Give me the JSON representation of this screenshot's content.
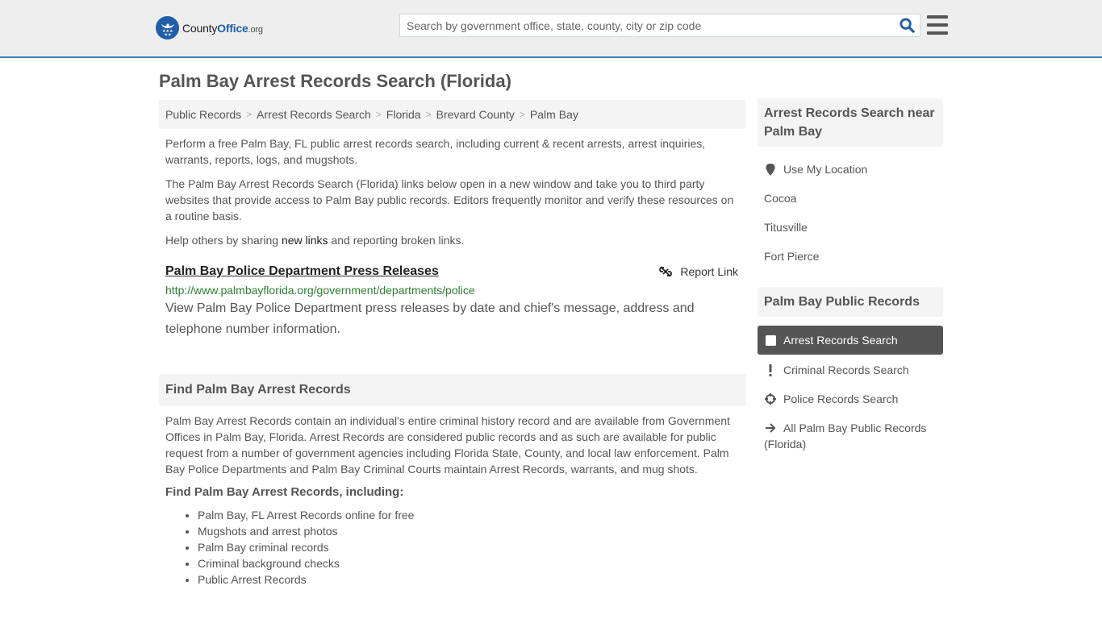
{
  "header": {
    "logo": {
      "name": "County",
      "brand": "Office",
      "tld": ".org"
    },
    "search": {
      "placeholder": "Search by government office, state, county, city or zip code",
      "value": ""
    },
    "colors": {
      "accent": "#3d7eb0",
      "brand": "#1f5fa8"
    }
  },
  "page": {
    "title": "Palm Bay Arrest Records Search (Florida)"
  },
  "breadcrumb": [
    {
      "label": "Public Records"
    },
    {
      "label": "Arrest Records Search"
    },
    {
      "label": "Florida"
    },
    {
      "label": "Brevard County"
    },
    {
      "label": "Palm Bay"
    }
  ],
  "breadcrumb_separator": ">",
  "intro": {
    "p1": "Perform a free Palm Bay, FL public arrest records search, including current & recent arrests, arrest inquiries, warrants, reports, logs, and mugshots.",
    "p2": "The Palm Bay Arrest Records Search (Florida) links below open in a new window and take you to third party websites that provide access to Palm Bay public records. Editors frequently monitor and verify these resources on a routine basis.",
    "p3_before": "Help others by sharing ",
    "p3_link": "new links",
    "p3_after": " and reporting broken links."
  },
  "links": [
    {
      "title": "Palm Bay Police Department Press Releases",
      "url": "http://www.palmbayflorida.org/government/departments/police",
      "description": "View Palm Bay Police Department press releases by date and chief's message, address and telephone number information.",
      "report_label": "Report Link"
    }
  ],
  "find_section": {
    "heading": "Find Palm Bay Arrest Records",
    "body": "Palm Bay Arrest Records contain an individual's entire criminal history record and are available from Government Offices in Palm Bay, Florida. Arrest Records are considered public records and as such are available for public request from a number of government agencies including Florida State, County, and local law enforcement. Palm Bay Police Departments and Palm Bay Criminal Courts maintain Arrest Records, warrants, and mug shots.",
    "subheading": "Find Palm Bay Arrest Records, including:",
    "bullets": [
      "Palm Bay, FL Arrest Records online for free",
      "Mugshots and arrest photos",
      "Palm Bay criminal records",
      "Criminal background checks",
      "Public Arrest Records"
    ]
  },
  "sidebar": {
    "nearby": {
      "heading": "Arrest Records Search near Palm Bay",
      "use_location": {
        "label": "Use My Location",
        "icon": "map-marker-icon"
      },
      "cities": [
        "Cocoa",
        "Titusville",
        "Fort Pierce"
      ]
    },
    "public_records": {
      "heading": "Palm Bay Public Records",
      "items": [
        {
          "label": "Arrest Records Search",
          "icon": "square-icon",
          "active": true
        },
        {
          "label": "Criminal Records Search",
          "icon": "exclamation-icon",
          "active": false
        },
        {
          "label": "Police Records Search",
          "icon": "crosshairs-icon",
          "active": false
        },
        {
          "label": "All Palm Bay Public Records (Florida)",
          "icon": "arrow-right-icon",
          "active": false
        }
      ]
    }
  }
}
